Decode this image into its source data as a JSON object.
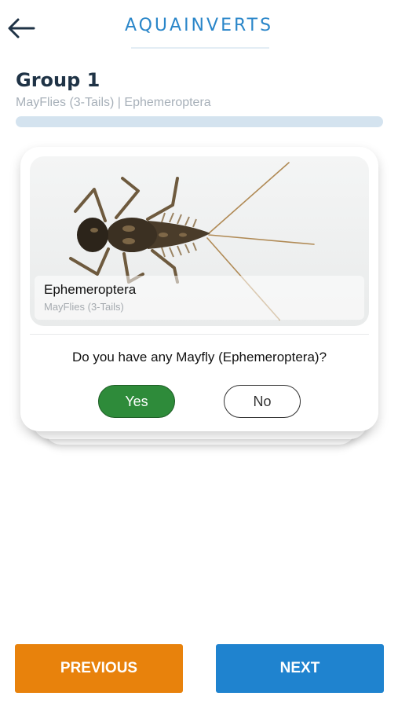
{
  "header": {
    "app_title": "AQUAINVERTS",
    "back_icon": "arrow-left-icon"
  },
  "group": {
    "title": "Group 1",
    "subtitle": "MayFlies (3-Tails) | Ephemeroptera",
    "progress": 0
  },
  "card": {
    "image_icon": "mayfly-nymph-photo",
    "name": "Ephemeroptera",
    "common_name": "MayFlies (3-Tails)",
    "question": "Do you have any Mayfly (Ephemeroptera)?",
    "yes_label": "Yes",
    "no_label": "No",
    "yes_color": "#2e8b3a"
  },
  "footer": {
    "previous_label": "PREVIOUS",
    "next_label": "NEXT",
    "previous_color": "#e8820c",
    "next_color": "#1f83cf"
  }
}
